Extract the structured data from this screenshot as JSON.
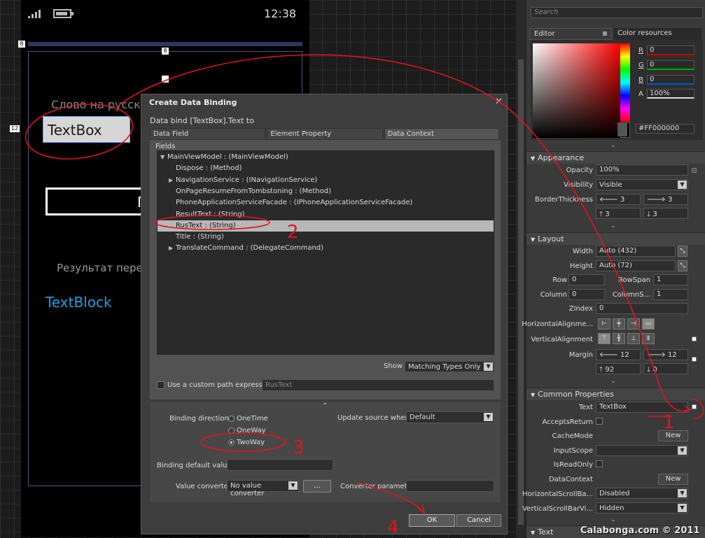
{
  "phone": {
    "clock": "12:38",
    "label_ru": "Слово на русско",
    "textbox_text": "TextBox",
    "button_text": "П",
    "result_label": "Результат перев",
    "textblock_text": "TextBlock",
    "margin_marker": "12",
    "top_marker": "8",
    "corner_marker": "8"
  },
  "dialog": {
    "title": "Create Data Binding",
    "close": "✕",
    "subtitle": "Data bind [TextBox].Text to",
    "tabs": [
      "Data Field",
      "Element Property",
      "Data Context"
    ],
    "fields_label": "Fields",
    "tree": [
      {
        "label": "MainViewModel : (MainViewModel)",
        "expander": "▼",
        "indent": 0,
        "selected": false
      },
      {
        "label": "Dispose : (Method)",
        "expander": "",
        "indent": 1,
        "selected": false
      },
      {
        "label": "NavigationService : (INavigationService)",
        "expander": "▶",
        "indent": 1,
        "selected": false
      },
      {
        "label": "OnPageResumeFromTombstoning : (Method)",
        "expander": "",
        "indent": 1,
        "selected": false
      },
      {
        "label": "PhoneApplicationServiceFacade : (IPhoneApplicationServiceFacade)",
        "expander": "",
        "indent": 1,
        "selected": false
      },
      {
        "label": "ResultText : (String)",
        "expander": "",
        "indent": 1,
        "selected": false
      },
      {
        "label": "RusText : (String)",
        "expander": "",
        "indent": 1,
        "selected": true
      },
      {
        "label": "Title : (String)",
        "expander": "",
        "indent": 1,
        "selected": false
      },
      {
        "label": "TranslateCommand : (DelegateCommand)",
        "expander": "▶",
        "indent": 1,
        "selected": false
      }
    ],
    "show_label": "Show",
    "show_value": "Matching Types Only",
    "custom_path_label": "Use a custom path expression",
    "custom_path_value": "RusText",
    "collapse_glyph": "⌃",
    "binding_direction_label": "Binding direction",
    "directions": [
      {
        "label": "OneTime",
        "checked": false
      },
      {
        "label": "OneWay",
        "checked": false
      },
      {
        "label": "TwoWay",
        "checked": true
      }
    ],
    "update_source_label": "Update source when",
    "update_source_value": "Default",
    "binding_default_label": "Binding default value",
    "value_converter_label": "Value converter",
    "value_converter_value": "No value converter",
    "ellipsis": "...",
    "converter_param_label": "Converter parameter",
    "ok": "OK",
    "cancel": "Cancel"
  },
  "props": {
    "search_placeholder": "Search",
    "tab_editor": "Editor",
    "tab_color_resources": "Color resources",
    "r_label": "R",
    "r_value": "0",
    "g_label": "G",
    "g_value": "0",
    "b_label": "B",
    "b_value": "0",
    "a_label": "A",
    "a_value": "100%",
    "hex_value": "#FF000000",
    "chevron": "⌄",
    "appearance": {
      "header": "Appearance",
      "opacity_label": "Opacity",
      "opacity_value": "100%",
      "visibility_label": "Visibility",
      "visibility_value": "Visible",
      "border_label": "BorderThickness",
      "border_left": "3",
      "border_right": "3",
      "border_top": "3",
      "border_bottom": "3"
    },
    "layout": {
      "header": "Layout",
      "width_label": "Width",
      "width_value": "Auto (432)",
      "height_label": "Height",
      "height_value": "Auto (72)",
      "row_label": "Row",
      "row_value": "0",
      "rowspan_label": "RowSpan",
      "rowspan_value": "1",
      "column_label": "Column",
      "column_value": "0",
      "columnspan_label": "ColumnS...",
      "columnspan_value": "1",
      "zindex_label": "ZIndex",
      "zindex_value": "0",
      "halign_label": "HorizontalAlignme...",
      "valign_label": "VerticalAlignment",
      "margin_label": "Margin",
      "margin_left": "12",
      "margin_right": "12",
      "margin_top": "92",
      "margin_bottom": "0"
    },
    "common": {
      "header": "Common Properties",
      "text_label": "Text",
      "text_value": "TextBox",
      "acceptsreturn_label": "AcceptsReturn",
      "cachemode_label": "CacheMode",
      "new1": "New",
      "inputscope_label": "InputScope",
      "isreadonly_label": "IsReadOnly",
      "datacontext_label": "DataContext",
      "new2": "New",
      "hscroll_label": "HorizontalScrollBa...",
      "hscroll_value": "Disabled",
      "vscroll_label": "VerticalScrollBarVi...",
      "vscroll_value": "Hidden"
    },
    "text_section": "Text"
  },
  "annotations": [
    "1",
    "2",
    "3",
    "4"
  ],
  "watermark": "Calabonga.com © 2011"
}
